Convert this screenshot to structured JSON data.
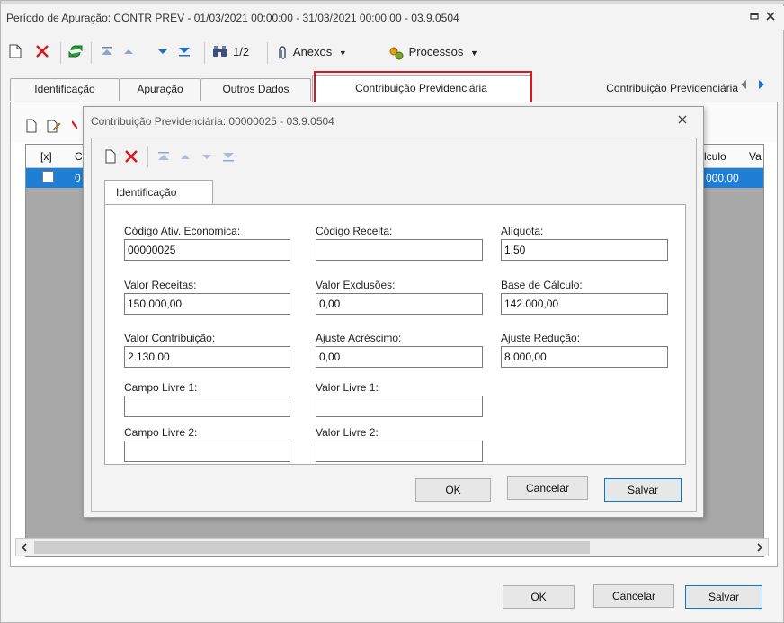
{
  "window": {
    "title": "Período de Apuração: CONTR PREV - 01/03/2021 00:00:00 - 31/03/2021 00:00:00 - 03.9.0504"
  },
  "toolbar": {
    "page_indicator": "1/2",
    "anexos_label": "Anexos",
    "processos_label": "Processos"
  },
  "tabs": [
    {
      "label": "Identificação"
    },
    {
      "label": "Apuração"
    },
    {
      "label": "Outros Dados"
    },
    {
      "label": "Contribuição Previdenciária"
    },
    {
      "label": "Contribuição  Previdenciária"
    }
  ],
  "grid": {
    "headers": {
      "check": "[x]",
      "c1": "C",
      "calculo": "lculo",
      "va": "Va"
    },
    "row": {
      "c1": "0",
      "calculo": "000,00"
    }
  },
  "dialog": {
    "title": "Contribuição Previdenciária: 00000025 - 03.9.0504",
    "tab_label": "Identificação",
    "fields": {
      "codigo_ativ_label": "Código Ativ. Economica:",
      "codigo_ativ_value": "00000025",
      "codigo_receita_label": "Código Receita:",
      "codigo_receita_value": "",
      "aliquota_label": "Alíquota:",
      "aliquota_value": "1,50",
      "valor_receitas_label": "Valor Receitas:",
      "valor_receitas_value": "150.000,00",
      "valor_exclusoes_label": "Valor Exclusões:",
      "valor_exclusoes_value": "0,00",
      "base_calculo_label": "Base de Cálculo:",
      "base_calculo_value": "142.000,00",
      "valor_contribuicao_label": "Valor Contribuição:",
      "valor_contribuicao_value": "2.130,00",
      "ajuste_acrescimo_label": "Ajuste Acréscimo:",
      "ajuste_acrescimo_value": "0,00",
      "ajuste_reducao_label": "Ajuste Redução:",
      "ajuste_reducao_value": "8.000,00",
      "campo_livre1_label": "Campo Livre 1:",
      "campo_livre1_value": "",
      "valor_livre1_label": "Valor Livre 1:",
      "valor_livre1_value": "",
      "campo_livre2_label": "Campo Livre 2:",
      "campo_livre2_value": "",
      "valor_livre2_label": "Valor Livre 2:",
      "valor_livre2_value": ""
    },
    "buttons": {
      "ok": "OK",
      "cancel": "Cancelar",
      "save": "Salvar"
    }
  },
  "footer": {
    "ok": "OK",
    "cancel": "Cancelar",
    "save": "Salvar"
  },
  "colors": {
    "selection": "#1e7fd4",
    "highlight": "#e0141e",
    "delete": "#e0141e",
    "arrow": "#1a6fd6"
  }
}
